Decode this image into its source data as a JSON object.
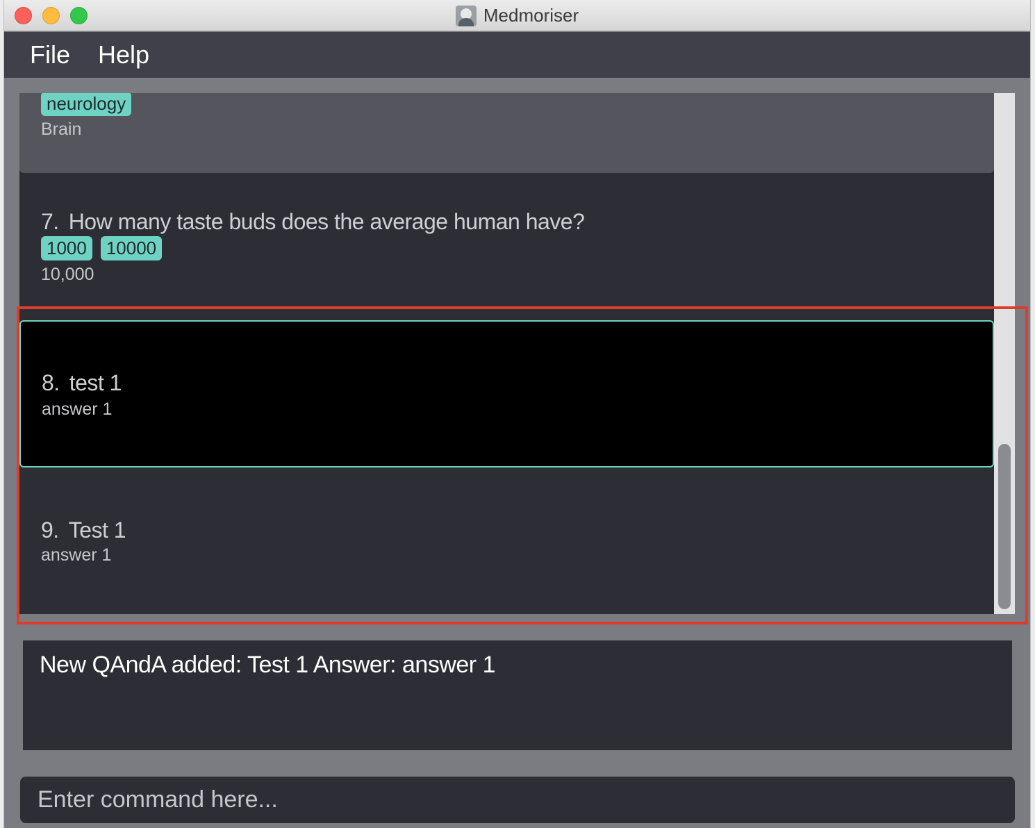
{
  "window": {
    "title": "Medmoriser",
    "app_icon": "brain-head-icon"
  },
  "menubar": {
    "items": [
      {
        "label": "File"
      },
      {
        "label": "Help"
      }
    ]
  },
  "qanda_list": {
    "items": [
      {
        "tags": [
          "neurology"
        ],
        "answer": "Brain"
      },
      {
        "index": "7.",
        "question": "How many taste buds does the average human have?",
        "tags": [
          "1000",
          "10000"
        ],
        "answer": "10,000"
      },
      {
        "index": "8.",
        "question": "test 1",
        "answer": "answer 1",
        "selected": true
      },
      {
        "index": "9.",
        "question": "Test 1",
        "answer": "answer 1"
      }
    ],
    "scroll_position": 0.96
  },
  "result_display": {
    "text": "New QAndA added: Test 1 Answer: answer 1"
  },
  "command_box": {
    "placeholder": "Enter command here...",
    "value": ""
  },
  "colors": {
    "tag": "#6ed3c2",
    "selected_border": "#6ed3c2",
    "highlight_annotation": "#e03c2d",
    "menubar": "#3f4049"
  }
}
